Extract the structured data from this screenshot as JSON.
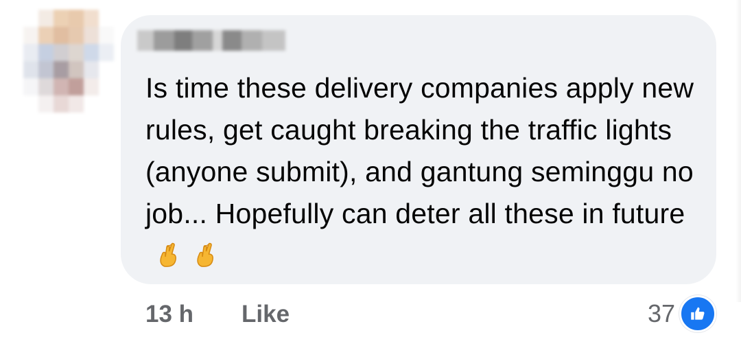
{
  "comment": {
    "author_name": "",
    "text": "Is time these delivery companies apply new rules, get caught breaking the traffic lights (anyone submit), and gantung seminggu no job... Hopefully can deter all these in future",
    "emojis": [
      "crossed-fingers-icon",
      "crossed-fingers-icon"
    ],
    "timestamp": "13 h",
    "like_label": "Like",
    "reaction_count": "37",
    "reaction_type": "like-icon"
  },
  "colors": {
    "bubble": "#f0f2f5",
    "text": "#050505",
    "meta": "#65676b",
    "like_blue": "#1877f2"
  }
}
